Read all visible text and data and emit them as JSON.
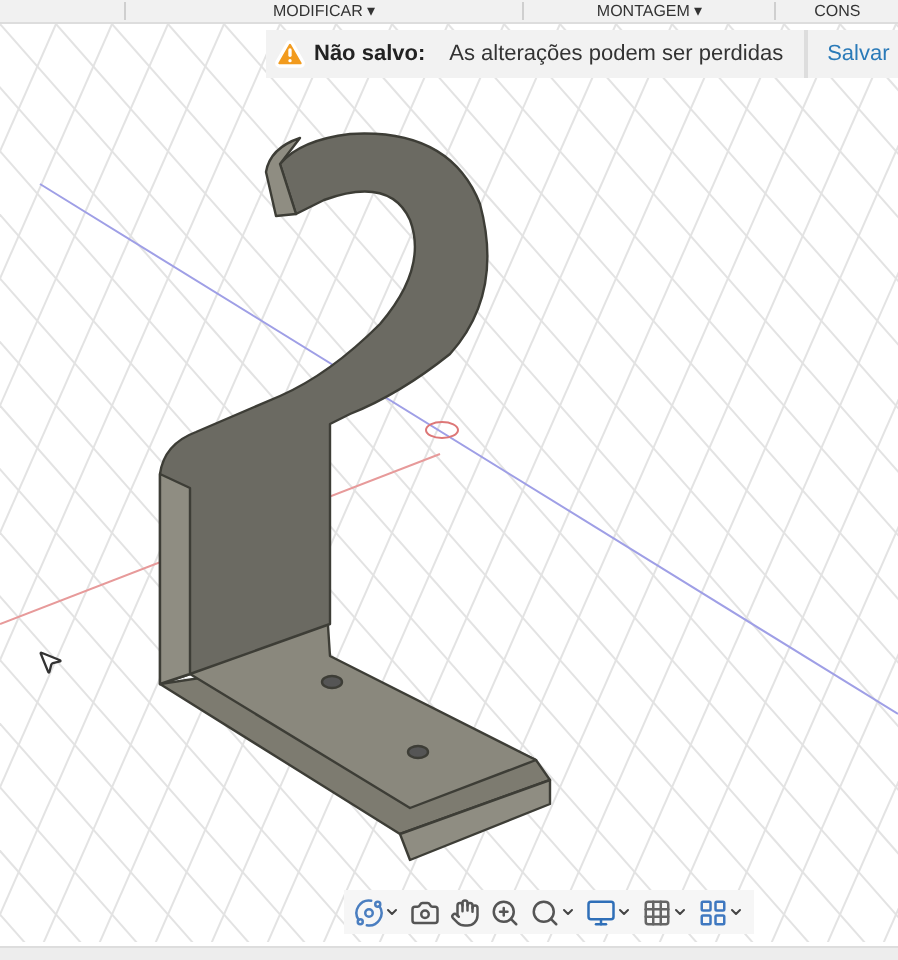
{
  "menu": [
    {
      "label": "MODIFICAR ▾"
    },
    {
      "label": "MONTAGEM ▾"
    },
    {
      "label": "CONS"
    }
  ],
  "banner": {
    "status": "Não salvo:",
    "message": "As alterações podem ser perdidas",
    "action": "Salvar"
  },
  "navigation_toolbar": [
    {
      "dropdown": true
    },
    {
      "dropdown": false
    },
    {
      "dropdown": false
    },
    {
      "dropdown": false
    },
    {
      "dropdown": true
    },
    {
      "dropdown": true
    },
    {
      "dropdown": true
    },
    {
      "dropdown": true
    }
  ]
}
